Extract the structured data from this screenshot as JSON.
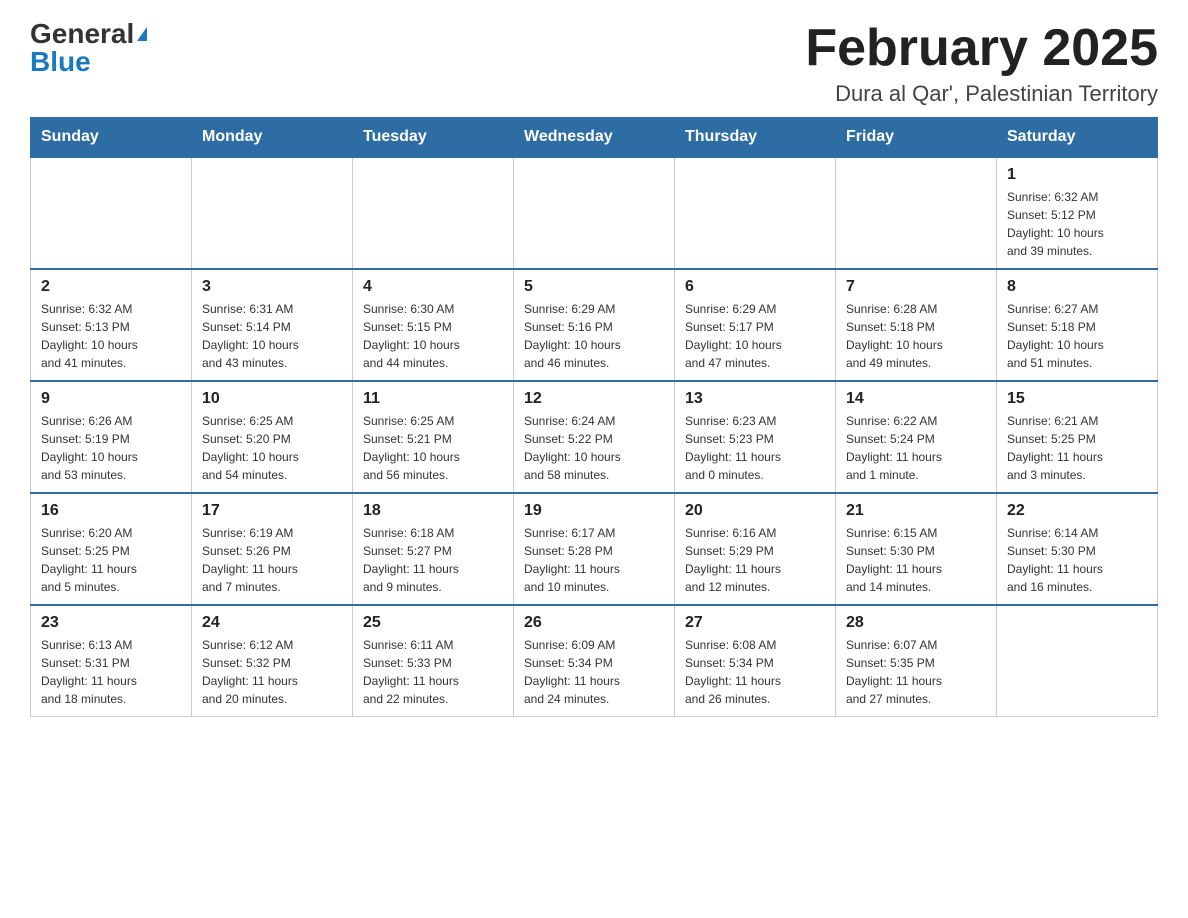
{
  "logo": {
    "general": "General",
    "blue": "Blue"
  },
  "title": "February 2025",
  "location": "Dura al Qar', Palestinian Territory",
  "days_of_week": [
    "Sunday",
    "Monday",
    "Tuesday",
    "Wednesday",
    "Thursday",
    "Friday",
    "Saturday"
  ],
  "weeks": [
    [
      {
        "day": "",
        "info": ""
      },
      {
        "day": "",
        "info": ""
      },
      {
        "day": "",
        "info": ""
      },
      {
        "day": "",
        "info": ""
      },
      {
        "day": "",
        "info": ""
      },
      {
        "day": "",
        "info": ""
      },
      {
        "day": "1",
        "info": "Sunrise: 6:32 AM\nSunset: 5:12 PM\nDaylight: 10 hours\nand 39 minutes."
      }
    ],
    [
      {
        "day": "2",
        "info": "Sunrise: 6:32 AM\nSunset: 5:13 PM\nDaylight: 10 hours\nand 41 minutes."
      },
      {
        "day": "3",
        "info": "Sunrise: 6:31 AM\nSunset: 5:14 PM\nDaylight: 10 hours\nand 43 minutes."
      },
      {
        "day": "4",
        "info": "Sunrise: 6:30 AM\nSunset: 5:15 PM\nDaylight: 10 hours\nand 44 minutes."
      },
      {
        "day": "5",
        "info": "Sunrise: 6:29 AM\nSunset: 5:16 PM\nDaylight: 10 hours\nand 46 minutes."
      },
      {
        "day": "6",
        "info": "Sunrise: 6:29 AM\nSunset: 5:17 PM\nDaylight: 10 hours\nand 47 minutes."
      },
      {
        "day": "7",
        "info": "Sunrise: 6:28 AM\nSunset: 5:18 PM\nDaylight: 10 hours\nand 49 minutes."
      },
      {
        "day": "8",
        "info": "Sunrise: 6:27 AM\nSunset: 5:18 PM\nDaylight: 10 hours\nand 51 minutes."
      }
    ],
    [
      {
        "day": "9",
        "info": "Sunrise: 6:26 AM\nSunset: 5:19 PM\nDaylight: 10 hours\nand 53 minutes."
      },
      {
        "day": "10",
        "info": "Sunrise: 6:25 AM\nSunset: 5:20 PM\nDaylight: 10 hours\nand 54 minutes."
      },
      {
        "day": "11",
        "info": "Sunrise: 6:25 AM\nSunset: 5:21 PM\nDaylight: 10 hours\nand 56 minutes."
      },
      {
        "day": "12",
        "info": "Sunrise: 6:24 AM\nSunset: 5:22 PM\nDaylight: 10 hours\nand 58 minutes."
      },
      {
        "day": "13",
        "info": "Sunrise: 6:23 AM\nSunset: 5:23 PM\nDaylight: 11 hours\nand 0 minutes."
      },
      {
        "day": "14",
        "info": "Sunrise: 6:22 AM\nSunset: 5:24 PM\nDaylight: 11 hours\nand 1 minute."
      },
      {
        "day": "15",
        "info": "Sunrise: 6:21 AM\nSunset: 5:25 PM\nDaylight: 11 hours\nand 3 minutes."
      }
    ],
    [
      {
        "day": "16",
        "info": "Sunrise: 6:20 AM\nSunset: 5:25 PM\nDaylight: 11 hours\nand 5 minutes."
      },
      {
        "day": "17",
        "info": "Sunrise: 6:19 AM\nSunset: 5:26 PM\nDaylight: 11 hours\nand 7 minutes."
      },
      {
        "day": "18",
        "info": "Sunrise: 6:18 AM\nSunset: 5:27 PM\nDaylight: 11 hours\nand 9 minutes."
      },
      {
        "day": "19",
        "info": "Sunrise: 6:17 AM\nSunset: 5:28 PM\nDaylight: 11 hours\nand 10 minutes."
      },
      {
        "day": "20",
        "info": "Sunrise: 6:16 AM\nSunset: 5:29 PM\nDaylight: 11 hours\nand 12 minutes."
      },
      {
        "day": "21",
        "info": "Sunrise: 6:15 AM\nSunset: 5:30 PM\nDaylight: 11 hours\nand 14 minutes."
      },
      {
        "day": "22",
        "info": "Sunrise: 6:14 AM\nSunset: 5:30 PM\nDaylight: 11 hours\nand 16 minutes."
      }
    ],
    [
      {
        "day": "23",
        "info": "Sunrise: 6:13 AM\nSunset: 5:31 PM\nDaylight: 11 hours\nand 18 minutes."
      },
      {
        "day": "24",
        "info": "Sunrise: 6:12 AM\nSunset: 5:32 PM\nDaylight: 11 hours\nand 20 minutes."
      },
      {
        "day": "25",
        "info": "Sunrise: 6:11 AM\nSunset: 5:33 PM\nDaylight: 11 hours\nand 22 minutes."
      },
      {
        "day": "26",
        "info": "Sunrise: 6:09 AM\nSunset: 5:34 PM\nDaylight: 11 hours\nand 24 minutes."
      },
      {
        "day": "27",
        "info": "Sunrise: 6:08 AM\nSunset: 5:34 PM\nDaylight: 11 hours\nand 26 minutes."
      },
      {
        "day": "28",
        "info": "Sunrise: 6:07 AM\nSunset: 5:35 PM\nDaylight: 11 hours\nand 27 minutes."
      },
      {
        "day": "",
        "info": ""
      }
    ]
  ]
}
